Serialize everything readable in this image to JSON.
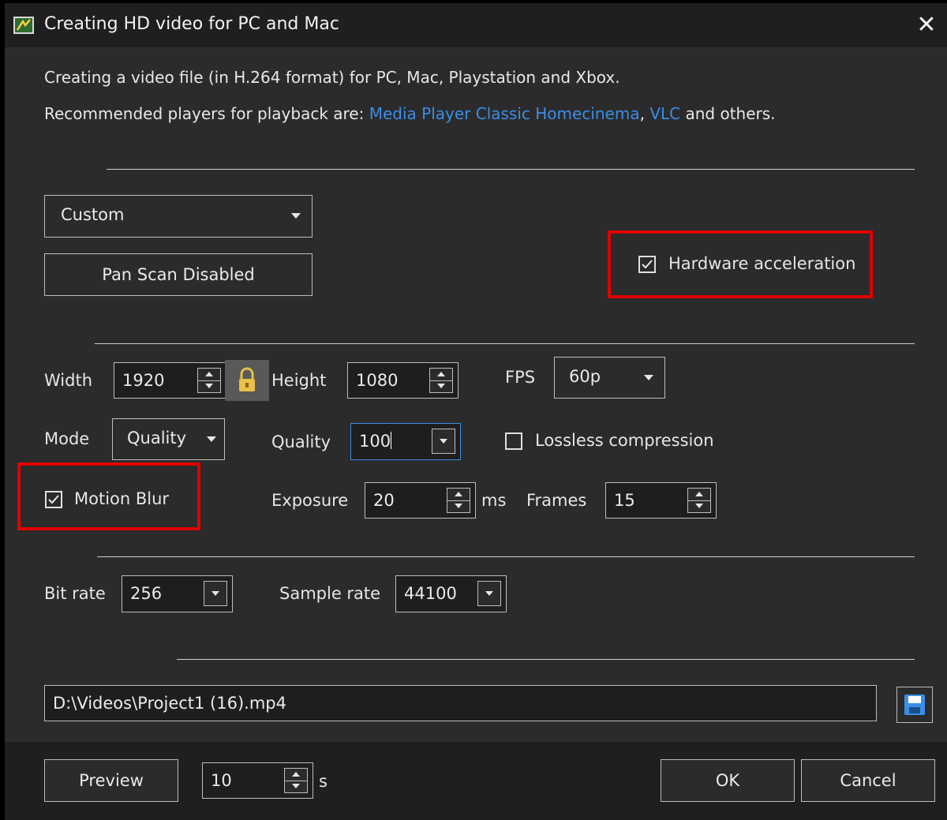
{
  "window": {
    "title": "Creating HD video for PC and Mac",
    "close_symbol": "✕"
  },
  "info": {
    "line1": "Creating a video file (in H.264 format) for PC, Mac, Playstation and Xbox.",
    "line2_prefix": "Recommended players for playback are: ",
    "link1": "Media Player Classic Homecinema",
    "comma": ",",
    "link2": "VLC",
    "line2_suffix": " and others."
  },
  "preset": {
    "value": "Custom"
  },
  "pan_scan_button": "Pan  Scan Disabled",
  "hardware_acceleration": {
    "label": "Hardware acceleration",
    "checked": true
  },
  "dimensions": {
    "width_label": "Width",
    "width_value": "1920",
    "height_label": "Height",
    "height_value": "1080",
    "fps_label": "FPS",
    "fps_value": "60p"
  },
  "mode": {
    "label": "Mode",
    "value": "Quality"
  },
  "quality": {
    "label": "Quality",
    "value": "100"
  },
  "lossless": {
    "label": "Lossless compression",
    "checked": false
  },
  "motion_blur": {
    "label": "Motion Blur",
    "checked": true
  },
  "exposure": {
    "label": "Exposure",
    "value": "20",
    "unit": "ms"
  },
  "frames": {
    "label": "Frames",
    "value": "15"
  },
  "bitrate": {
    "label": "Bit rate",
    "value": "256"
  },
  "sample_rate": {
    "label": "Sample rate",
    "value": "44100"
  },
  "output_path": "D:\\Videos\\Project1 (16).mp4",
  "preview": {
    "label": "Preview",
    "duration": "10",
    "unit": "s"
  },
  "ok_label": "OK",
  "cancel_label": "Cancel",
  "colors": {
    "link": "#3a8ee6",
    "highlight": "#e00000",
    "background": "#2b2b2b"
  }
}
